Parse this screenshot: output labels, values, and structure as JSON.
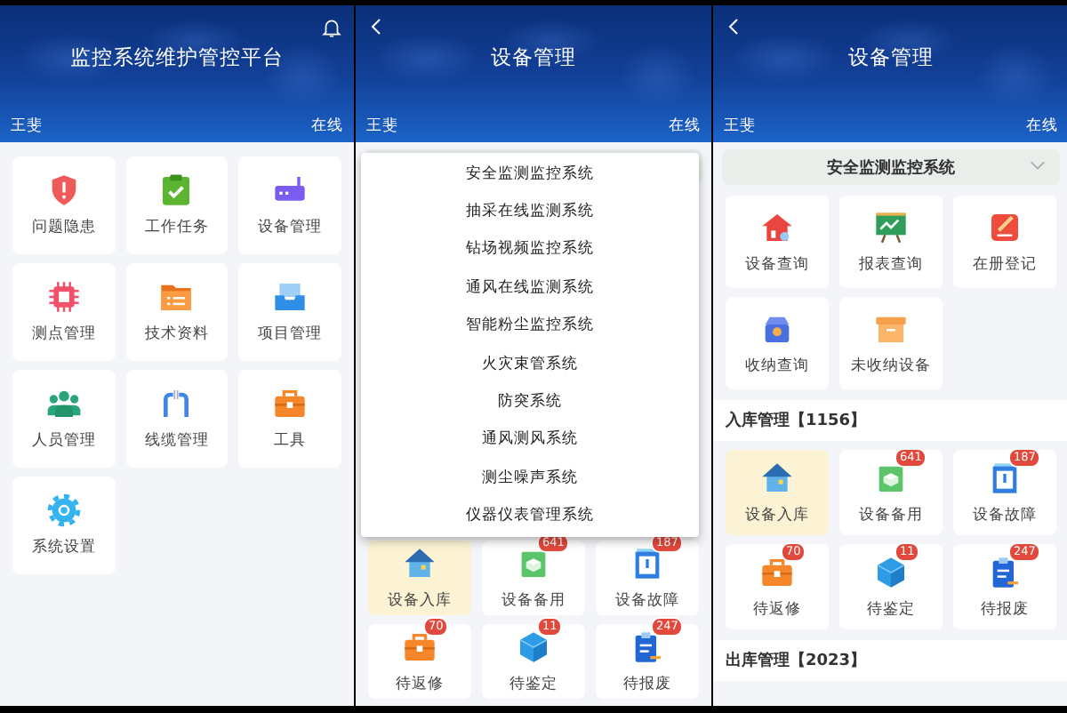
{
  "screens": [
    {
      "header": {
        "kind": "home",
        "title": "监控系统维护管控平台",
        "user": "王斐",
        "status": "在线"
      },
      "tiles": [
        {
          "label": "问题隐患"
        },
        {
          "label": "工作任务"
        },
        {
          "label": "设备管理"
        },
        {
          "label": "测点管理"
        },
        {
          "label": "技术资料"
        },
        {
          "label": "项目管理"
        },
        {
          "label": "人员管理"
        },
        {
          "label": "线缆管理"
        },
        {
          "label": "工具"
        },
        {
          "label": "系统设置"
        }
      ]
    },
    {
      "header": {
        "kind": "detail",
        "title": "设备管理",
        "user": "王斐",
        "status": "在线"
      },
      "dropdown": {
        "options": [
          "安全监测监控系统",
          "抽采在线监测系统",
          "钻场视频监控系统",
          "通风在线监测系统",
          "智能粉尘监控系统",
          "火灾束管系统",
          "防突系统",
          "通风测风系统",
          "测尘噪声系统",
          "仪器仪表管理系统"
        ]
      },
      "tiles": [
        {
          "label": "设备入库",
          "selected": true
        },
        {
          "label": "设备备用",
          "badge": "641",
          "selected": false
        },
        {
          "label": "设备故障",
          "badge": "187",
          "selected": false
        },
        {
          "label": "待返修",
          "badge": "70",
          "selected": false
        },
        {
          "label": "待鉴定",
          "badge": "11",
          "selected": false
        },
        {
          "label": "待报废",
          "badge": "247",
          "selected": false
        }
      ]
    },
    {
      "header": {
        "kind": "detail",
        "title": "设备管理",
        "user": "王斐",
        "status": "在线"
      },
      "select": {
        "value": "安全监测监控系统"
      },
      "tiles": [
        {
          "label": "设备查询"
        },
        {
          "label": "报表查询"
        },
        {
          "label": "在册登记"
        },
        {
          "label": "收纳查询"
        },
        {
          "label": "未收纳设备"
        }
      ],
      "sections": [
        {
          "title": "入库管理【1156】",
          "tiles": [
            {
              "label": "设备入库",
              "selected": true
            },
            {
              "label": "设备备用",
              "badge": "641",
              "selected": false
            },
            {
              "label": "设备故障",
              "badge": "187",
              "selected": false
            },
            {
              "label": "待返修",
              "badge": "70",
              "selected": false
            },
            {
              "label": "待鉴定",
              "badge": "11",
              "selected": false
            },
            {
              "label": "待报废",
              "badge": "247",
              "selected": false
            }
          ]
        },
        {
          "title": "出库管理【2023】"
        }
      ]
    }
  ]
}
